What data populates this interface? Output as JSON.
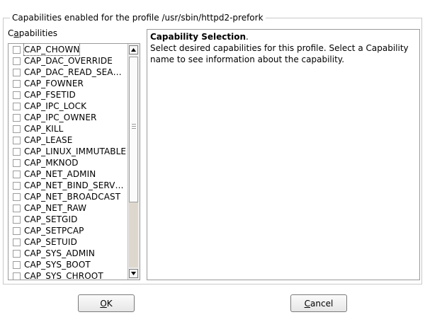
{
  "frame": {
    "title": "Capabilities enabled for the profile /usr/sbin/httpd2-prefork"
  },
  "capabilities_label": {
    "pre": "C",
    "mnemonic": "a",
    "post": "pabilities"
  },
  "capabilities": [
    {
      "label": "CAP_CHOWN",
      "checked": false
    },
    {
      "label": "CAP_DAC_OVERRIDE",
      "checked": false
    },
    {
      "label": "CAP_DAC_READ_SEA…",
      "checked": false
    },
    {
      "label": "CAP_FOWNER",
      "checked": false
    },
    {
      "label": "CAP_FSETID",
      "checked": false
    },
    {
      "label": "CAP_IPC_LOCK",
      "checked": false
    },
    {
      "label": "CAP_IPC_OWNER",
      "checked": false
    },
    {
      "label": "CAP_KILL",
      "checked": false
    },
    {
      "label": "CAP_LEASE",
      "checked": false
    },
    {
      "label": "CAP_LINUX_IMMUTABLE",
      "checked": false
    },
    {
      "label": "CAP_MKNOD",
      "checked": false
    },
    {
      "label": "CAP_NET_ADMIN",
      "checked": false
    },
    {
      "label": "CAP_NET_BIND_SERV…",
      "checked": false
    },
    {
      "label": "CAP_NET_BROADCAST",
      "checked": false
    },
    {
      "label": "CAP_NET_RAW",
      "checked": false
    },
    {
      "label": "CAP_SETGID",
      "checked": false
    },
    {
      "label": "CAP_SETPCAP",
      "checked": false
    },
    {
      "label": "CAP_SETUID",
      "checked": false
    },
    {
      "label": "CAP_SYS_ADMIN",
      "checked": false
    },
    {
      "label": "CAP_SYS_BOOT",
      "checked": false
    },
    {
      "label": "CAP_SYS_CHROOT",
      "checked": false
    }
  ],
  "info": {
    "title": "Capability Selection",
    "title_suffix": ".",
    "body": "Select desired capabilities for this profile. Select a Capability name to see information about the capability."
  },
  "buttons": {
    "ok": {
      "mnemonic": "O",
      "rest": "K"
    },
    "cancel": {
      "mnemonic": "C",
      "rest": "ancel"
    }
  }
}
